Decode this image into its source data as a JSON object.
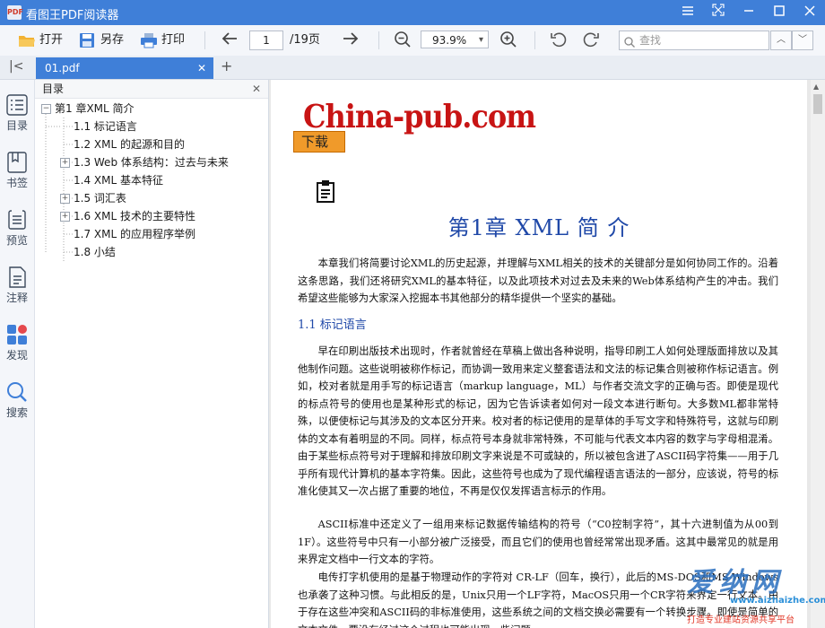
{
  "app": {
    "title": "看图王PDF阅读器",
    "icon_text": "PDF"
  },
  "window_controls": [
    "menu-icon",
    "fullscreen-icon",
    "minimize-icon",
    "maximize-icon",
    "close-icon"
  ],
  "toolbar": {
    "open_label": "打开",
    "saveas_label": "另存",
    "print_label": "打印",
    "page_value": "1",
    "page_total": "/19页",
    "zoom_value": "93.9%",
    "search_placeholder": "查找"
  },
  "tabs": [
    {
      "label": "01.pdf"
    }
  ],
  "sidebar": {
    "items": [
      {
        "label": "目录",
        "icon": "toc-icon"
      },
      {
        "label": "书签",
        "icon": "bookmark-icon"
      },
      {
        "label": "预览",
        "icon": "preview-icon"
      },
      {
        "label": "注释",
        "icon": "annotation-icon"
      },
      {
        "label": "发现",
        "icon": "discover-icon"
      },
      {
        "label": "搜索",
        "icon": "search-icon"
      }
    ]
  },
  "outline": {
    "title": "目录",
    "items": [
      {
        "label": "第1 章XML 简介",
        "expander": "−"
      },
      {
        "label": "1.1 标记语言",
        "expander": ""
      },
      {
        "label": "1.2 XML 的起源和目的",
        "expander": ""
      },
      {
        "label": "1.3 Web 体系结构：过去与未来",
        "expander": "+"
      },
      {
        "label": "1.4 XML 基本特征",
        "expander": ""
      },
      {
        "label": "1.5 词汇表",
        "expander": "+"
      },
      {
        "label": "1.6 XML 技术的主要特性",
        "expander": "+"
      },
      {
        "label": "1.7 XML 的应用程序举例",
        "expander": ""
      },
      {
        "label": "1.8 小结",
        "expander": ""
      }
    ]
  },
  "document": {
    "logo": "China-pub.com",
    "download_label": "下载",
    "chapter_title": "第1章   XML   简   介",
    "intro": "本章我们将简要讨论XML的历史起源，并理解与XML相关的技术的关键部分是如何协同工作的。沿着这条思路，我们还将研究XML的基本特征，以及此项技术对过去及未来的Web体系结构产生的冲击。我们希望这些能够为大家深入挖掘本书其他部分的精华提供一个坚实的基础。",
    "section_title": "1.1   标记语言",
    "para1": "早在印刷出版技术出现时，作者就曾经在草稿上做出各种说明，指导印刷工人如何处理版面排放以及其他制作问题。这些说明被称作标记，而协调一致用来定义整套语法和文法的标记集合则被称作标记语言。例如，校对者就是用手写的标记语言（markup language，ML）与作者交流文字的正确与否。即使是现代的标点符号的使用也是某种形式的标记，因为它告诉读者如何对一段文本进行断句。大多数ML都非常特殊，以便使标记与其涉及的文本区分开来。校对者的标记使用的是草体的手写文字和特殊符号，这就与印刷体的文本有着明显的不同。同样，标点符号本身就非常特殊，不可能与代表文本内容的数字与字母相混淆。由于某些标点符号对于理解和排放印刷文字来说是不可或缺的，所以被包含进了ASCII码字符集——用于几乎所有现代计算机的基本字符集。因此，这些符号也成为了现代编程语言语法的一部分，应该说，符号的标准化使其又一次占据了重要的地位，不再是仅仅发挥语言标示的作用。",
    "para2": "ASCII标准中还定义了一组用来标记数据传输结构的符号（“C0控制字符”，其十六进制值为从00到1F）。这些符号中只有一小部分被广泛接受，而且它们的使用也曾经常常出现矛盾。这其中最常见的就是用来界定文档中一行文本的字符。",
    "para3": "电传打字机使用的是基于物理动作的字符对 CR-LF（回车，换行），此后的MS-DOS和MS-Windows也承袭了这种习惯。与此相反的是，Unix只用一个LF字符，MacOS只用一个CR字符来界定一行文本。由于存在这些冲突和ASCII码的非标准使用，这些系统之间的文档交换必需要有一个转换步骤。即使是简单的文本文件，要没有经过这个过程也可能出现一些问题。"
  },
  "watermark": {
    "big": "爱纳网",
    "url": "www.aizhaizhe.com",
    "sub": "打造专业建站资源共享平台"
  }
}
